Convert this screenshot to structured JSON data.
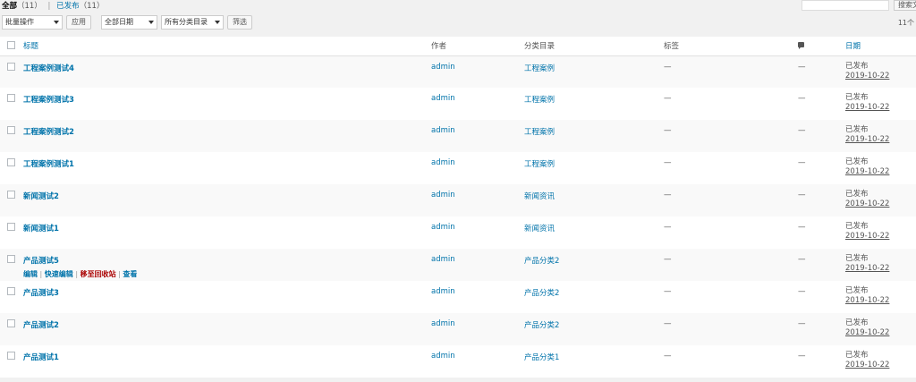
{
  "views": {
    "all_label": "全部",
    "all_count": "（11）",
    "separator": "|",
    "published_label": "已发布",
    "published_count": "（11）"
  },
  "search": {
    "button_label": "搜索文"
  },
  "toolbar": {
    "bulk_action": "批量操作",
    "apply": "应用",
    "date_filter": "全部日期",
    "category_filter": "所有分类目录",
    "filter": "筛选",
    "item_count": "11个"
  },
  "columns": {
    "title": "标题",
    "author": "作者",
    "categories": "分类目录",
    "tags": "标签",
    "comments_icon": "comment-icon",
    "date": "日期"
  },
  "row_actions": {
    "edit": "编辑",
    "quick_edit": "快速编辑",
    "trash": "移至回收站",
    "view": "查看",
    "sep": "|"
  },
  "posts": [
    {
      "title": "工程案例测试4",
      "author": "admin",
      "category": "工程案例",
      "tags": "—",
      "comments": "—",
      "status": "已发布",
      "date": "2019-10-22"
    },
    {
      "title": "工程案例测试3",
      "author": "admin",
      "category": "工程案例",
      "tags": "—",
      "comments": "—",
      "status": "已发布",
      "date": "2019-10-22"
    },
    {
      "title": "工程案例测试2",
      "author": "admin",
      "category": "工程案例",
      "tags": "—",
      "comments": "—",
      "status": "已发布",
      "date": "2019-10-22"
    },
    {
      "title": "工程案例测试1",
      "author": "admin",
      "category": "工程案例",
      "tags": "—",
      "comments": "—",
      "status": "已发布",
      "date": "2019-10-22"
    },
    {
      "title": "新闻测试2",
      "author": "admin",
      "category": "新闻资讯",
      "tags": "—",
      "comments": "—",
      "status": "已发布",
      "date": "2019-10-22"
    },
    {
      "title": "新闻测试1",
      "author": "admin",
      "category": "新闻资讯",
      "tags": "—",
      "comments": "—",
      "status": "已发布",
      "date": "2019-10-22"
    },
    {
      "title": "产品测试5",
      "author": "admin",
      "category": "产品分类2",
      "tags": "—",
      "comments": "—",
      "status": "已发布",
      "date": "2019-10-22"
    },
    {
      "title": "产品测试3",
      "author": "admin",
      "category": "产品分类2",
      "tags": "—",
      "comments": "—",
      "status": "已发布",
      "date": "2019-10-22"
    },
    {
      "title": "产品测试2",
      "author": "admin",
      "category": "产品分类2",
      "tags": "—",
      "comments": "—",
      "status": "已发布",
      "date": "2019-10-22"
    },
    {
      "title": "产品测试1",
      "author": "admin",
      "category": "产品分类1",
      "tags": "—",
      "comments": "—",
      "status": "已发布",
      "date": "2019-10-22"
    }
  ]
}
